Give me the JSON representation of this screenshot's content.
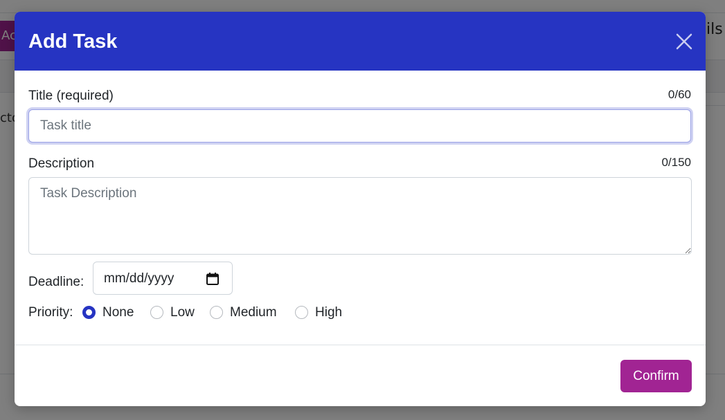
{
  "background": {
    "add_button_fragment": "Ac",
    "left_text_fragment": "cto",
    "right_text_fragment": "ils"
  },
  "modal": {
    "title": "Add Task",
    "close_icon": "close-icon",
    "title_field": {
      "label": "Title (required)",
      "counter": "0/60",
      "placeholder": "Task title",
      "value": ""
    },
    "description_field": {
      "label": "Description",
      "counter": "0/150",
      "placeholder": "Task Description",
      "value": ""
    },
    "deadline": {
      "label": "Deadline:",
      "placeholder": "mm/dd/yyyy",
      "icon": "calendar-icon"
    },
    "priority": {
      "label": "Priority:",
      "options": [
        "None",
        "Low",
        "Medium",
        "High"
      ],
      "selected": "None"
    },
    "confirm_label": "Confirm"
  },
  "colors": {
    "header": "#2634c2",
    "accent": "#a12493",
    "radio_checked": "#2634c2"
  }
}
